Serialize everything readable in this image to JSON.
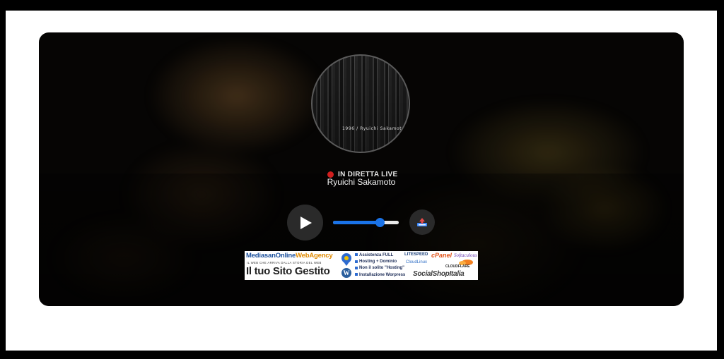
{
  "station": {
    "cover_caption": "1996 / Ryuichi Sakamoto",
    "live_label": "IN DIRETTA LIVE",
    "artist": "Ryuichi Sakamoto"
  },
  "controls": {
    "play_icon": "play-icon",
    "share_icon": "share-icon",
    "volume_level": 0.71,
    "accent_color": "#1a73e8",
    "live_color": "#d11e1e"
  },
  "banner": {
    "brand_main": "MediasanOnline",
    "brand_accent": "WebAgency",
    "tagline": "IL WEB CHE ARRIVA DALLA STORIA DEL WEB",
    "headline": "Il tuo Sito Gestito",
    "features": [
      "Assistenza FULL",
      "Hosting + Dominio",
      "Non il solito \"Hosting\"",
      "Installazione Worpress"
    ],
    "logo_litespeed": "LITESPEED",
    "logo_cpanel": "cPanel",
    "logo_signature": "Softaculous",
    "logo_cloudlinux": "CloudLinux",
    "logo_cloudflare": "CLOUDFLARE",
    "logo_socialshop": "SocialShopItalia"
  }
}
